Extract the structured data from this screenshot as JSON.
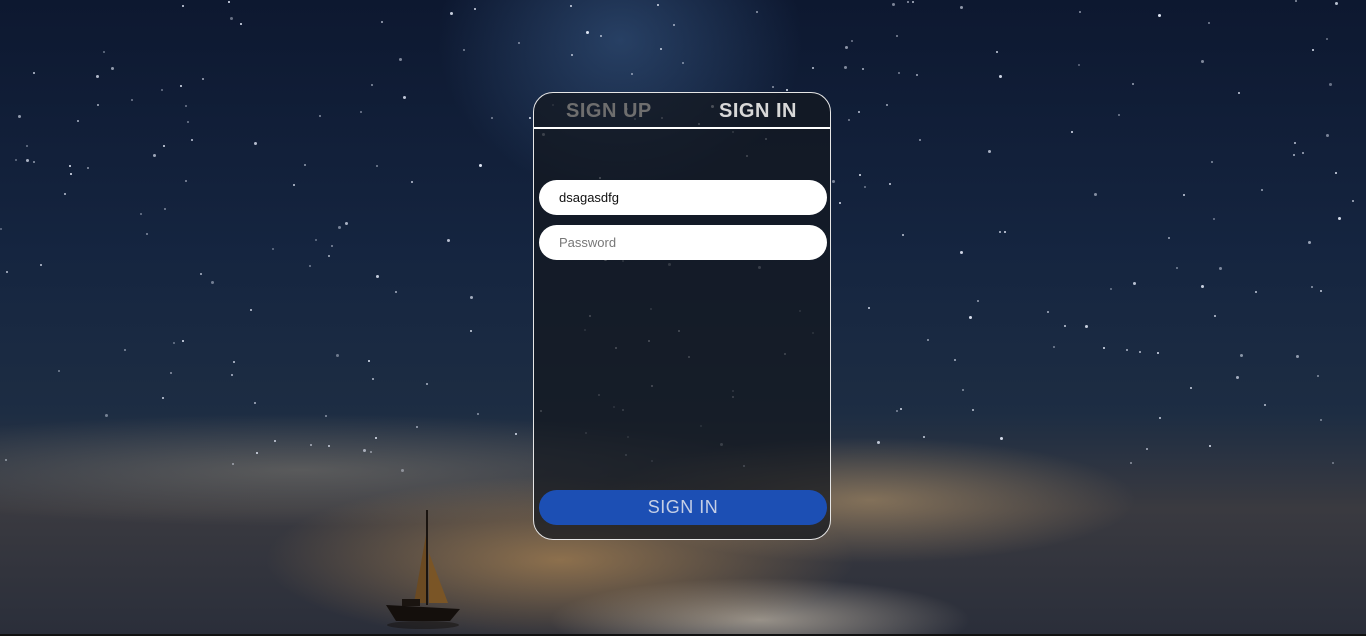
{
  "tabs": {
    "signup_label": "SIGN UP",
    "signin_label": "SIGN IN",
    "active": "signin"
  },
  "form": {
    "username_value": "dsagasdfg",
    "password_placeholder": "Password",
    "password_value": "",
    "submit_label": "SIGN IN"
  },
  "colors": {
    "submit_button": "#1c4fb4",
    "active_tab": "#d8d8d8",
    "inactive_tab": "#6e6e6e"
  }
}
